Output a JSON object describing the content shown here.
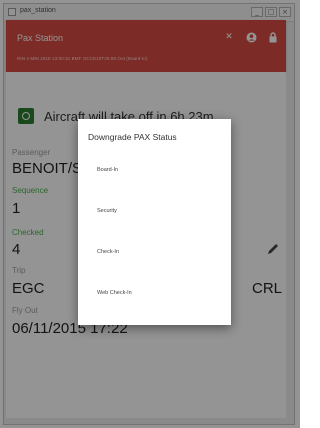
{
  "window": {
    "title": "pax_station",
    "buttons": [
      "_",
      "□",
      "×"
    ]
  },
  "appbar": {
    "title": "Pax Station",
    "subtitle": "RIN 4 MIN 2015 13:00:31 BMF    OCCE10T25:55 Out (Board-In)",
    "icons": [
      "close-icon",
      "account-circle-icon",
      "lock-icon"
    ]
  },
  "alert": {
    "icon": "plane-check-icon",
    "text": "Aircraft will take off in 6h 23m"
  },
  "fields": {
    "passenger_label": "Passenger",
    "passenger_value": "BENOIT/S",
    "sequence_label": "Sequence",
    "sequence_value": "1",
    "checked_label": "Checked",
    "checked_value": "4",
    "trip_label": "Trip",
    "trip_from": "EGC",
    "trip_to": "CRL",
    "flyout_label": "Fly Out",
    "flyout_value": "06/11/2015 17:22"
  },
  "dialog": {
    "title": "Downgrade PAX Status",
    "options": [
      "Board-In",
      "Security",
      "Check-In",
      "Web Check-In"
    ]
  },
  "colors": {
    "appbar": "#d64a42",
    "green": "#4caf50",
    "icon_green": "#2e7d32"
  }
}
